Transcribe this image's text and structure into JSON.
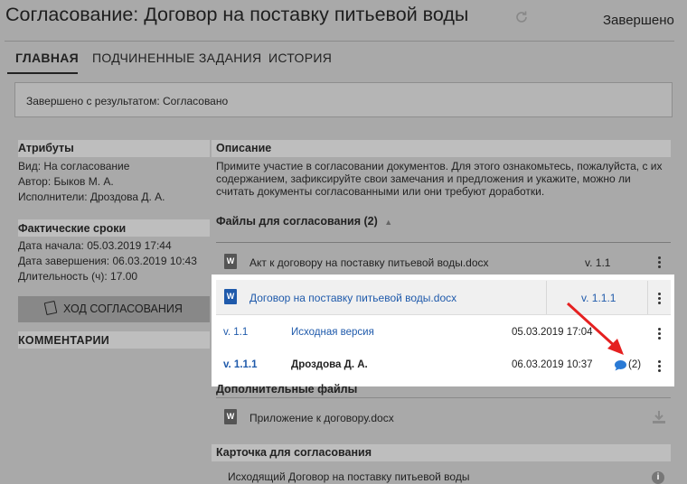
{
  "header": {
    "title": "Согласование:  Договор на поставку питьевой воды",
    "status": "Завершено"
  },
  "tabs": [
    {
      "label": "ГЛАВНАЯ",
      "active": true
    },
    {
      "label": "ПОДЧИНЕННЫЕ ЗАДАНИЯ",
      "active": false
    },
    {
      "label": "ИСТОРИЯ",
      "active": false
    }
  ],
  "banner": {
    "text": "Завершено с результатом: Согласовано"
  },
  "attributes": {
    "heading": "Атрибуты",
    "kind": "Вид: На согласование",
    "author": "Автор: Быков М. А.",
    "performers": "Исполнители: Дроздова Д. А."
  },
  "dates": {
    "heading": "Фактические сроки",
    "start": "Дата начала: 05.03.2019 17:44",
    "end": "Дата завершения: 06.03.2019 10:43",
    "duration": "Длительность (ч): 17.00"
  },
  "progress_button": {
    "label": "ХОД СОГЛАСОВАНИЯ"
  },
  "comments": {
    "heading": "КОММЕНТАРИИ"
  },
  "description": {
    "heading": "Описание",
    "line1": "Примите участие в согласовании документов. Для этого ознакомьтесь, пожалуйста, с их",
    "line2": "содержанием, зафиксируйте свои замечания и предложения и укажите, можно ли",
    "line3": "считать документы согласованными или они требуют доработки."
  },
  "files": {
    "heading": "Файлы для согласования (2)",
    "items": [
      {
        "name": "Акт к договору на поставку питьевой воды.docx",
        "version": "v. 1.1"
      },
      {
        "name": "Договор на поставку питьевой воды.docx",
        "version": "v. 1.1.1"
      }
    ],
    "versions": [
      {
        "version": "v. 1.1",
        "author": "Исходная версия",
        "date": "05.03.2019 17:04"
      },
      {
        "version": "v. 1.1.1",
        "author": "Дроздова Д. А.",
        "date": "06.03.2019 10:37",
        "comments": "(2)"
      }
    ]
  },
  "additional": {
    "heading": "Дополнительные файлы",
    "items": [
      {
        "name": "Приложение к договору.docx"
      }
    ]
  },
  "card": {
    "heading": "Карточка для согласования",
    "item": "Исходящий Договор на поставку питьевой воды"
  },
  "icons": {
    "doc": "word-doc-icon",
    "refresh": "refresh-icon",
    "comment": "comment-bubble-icon",
    "download": "download-icon",
    "info": "info-icon"
  },
  "colors": {
    "link": "#1f5aab",
    "annotation_arrow": "#e52020",
    "background": "#a9a9a9"
  }
}
